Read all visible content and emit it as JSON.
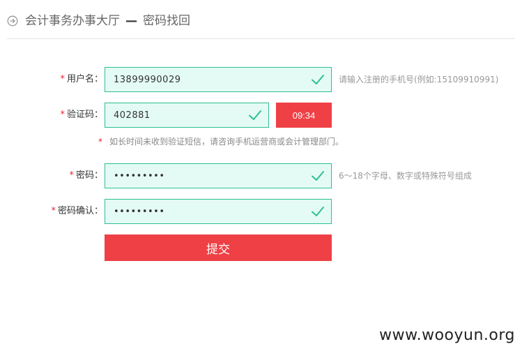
{
  "header": {
    "title": "会计事务办事大厅",
    "separator": "—",
    "subtitle": "密码找回"
  },
  "form": {
    "username": {
      "label": "用户名：",
      "value": "13899990029",
      "hint": "请输入注册的手机号(例如:15109910991)"
    },
    "code": {
      "label": "验证码：",
      "value": "402881",
      "timer": "09:34"
    },
    "notice": "如长时间未收到验证短信，请咨询手机运营商或会计管理部门。",
    "password": {
      "label": "密码：",
      "value": "•••••••••",
      "hint": "6～18个字母、数字或特殊符号组成"
    },
    "confirm": {
      "label": "密码确认：",
      "value": "•••••••••"
    },
    "required_mark": "*",
    "submit_label": "提交"
  },
  "watermark": "www.wooyun.org",
  "colors": {
    "accent_red": "#ef4045",
    "field_border": "#2cbf93",
    "field_bg": "#e4fbf5"
  },
  "icons": {
    "back": "circle-arrow-right-icon",
    "valid": "check-icon"
  }
}
